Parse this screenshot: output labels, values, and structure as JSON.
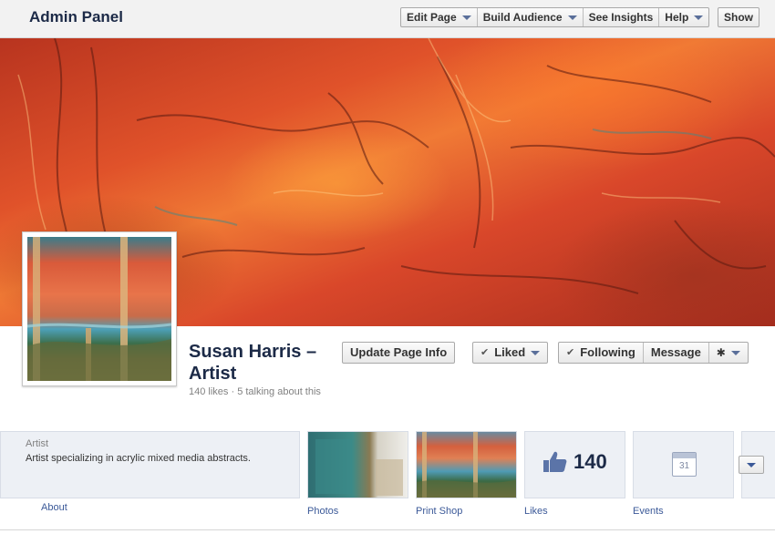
{
  "admin_bar": {
    "title": "Admin Panel",
    "menu": [
      {
        "label": "Edit Page"
      },
      {
        "label": "Build Audience"
      },
      {
        "label": "See Insights"
      },
      {
        "label": "Help"
      }
    ],
    "show_label": "Show"
  },
  "profile": {
    "name": "Susan Harris – Artist",
    "stats": "140 likes · 5 talking about this"
  },
  "actions": {
    "update_info": "Update Page Info",
    "liked": "Liked",
    "following": "Following",
    "message": "Message"
  },
  "about": {
    "category": "Artist",
    "description": "Artist specializing in acrylic mixed media abstracts.",
    "link": "About"
  },
  "apps": [
    {
      "label": "Photos"
    },
    {
      "label": "Print Shop"
    },
    {
      "label": "Likes",
      "count": "140"
    },
    {
      "label": "Events",
      "calendar_day": "31"
    }
  ],
  "icons": [
    "caret-down-icon",
    "check-icon",
    "gear-icon",
    "thumbs-up-icon",
    "calendar-icon"
  ],
  "colors": {
    "brand": "#3b5998",
    "name": "#1c2a47"
  }
}
